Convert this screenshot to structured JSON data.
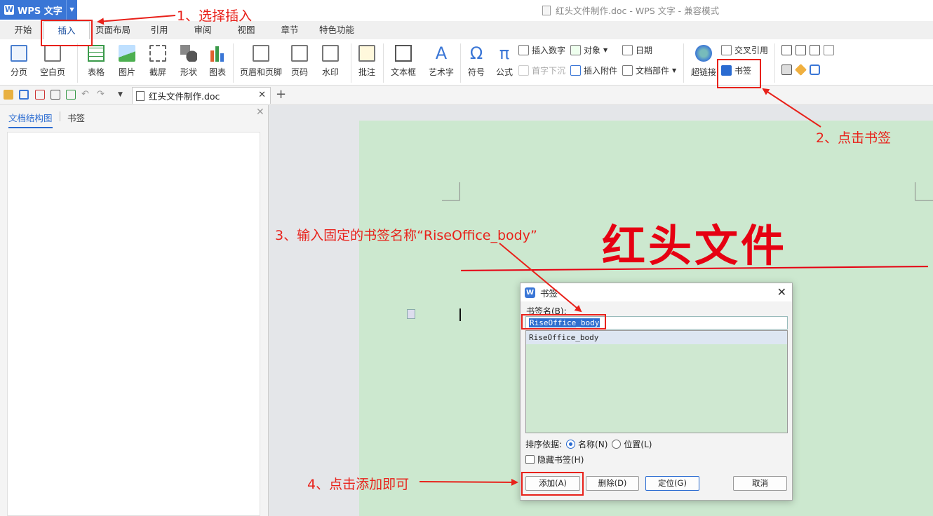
{
  "app": {
    "name": "WPS 文字",
    "window_title": "红头文件制作.doc - WPS 文字 - 兼容模式"
  },
  "menu_tabs": [
    "开始",
    "插入",
    "页面布局",
    "引用",
    "审阅",
    "视图",
    "章节",
    "特色功能"
  ],
  "active_tab": "插入",
  "ribbon": {
    "large": [
      "分页",
      "空白页",
      "表格",
      "图片",
      "截屏",
      "形状",
      "图表",
      "页眉和页脚",
      "页码",
      "水印",
      "批注",
      "文本框",
      "艺术字",
      "符号",
      "公式",
      "超链接"
    ],
    "small": {
      "insert_number": "插入数字",
      "object": "对象",
      "date": "日期",
      "drop_cap": "首字下沉",
      "attach": "插入附件",
      "doc_parts": "文档部件",
      "cross_ref": "交叉引用",
      "bookmark": "书签"
    }
  },
  "document_tab": "红头文件制作.doc",
  "left_pane": {
    "tabs": [
      "文档结构图",
      "书签"
    ]
  },
  "document": {
    "red_title": "红头文件"
  },
  "dialog": {
    "title": "书签",
    "name_label": "书签名(B):",
    "name_value": "RiseOffice_body",
    "list_items": [
      "RiseOffice_body"
    ],
    "sort_label": "排序依据:",
    "sort_by_name": "名称(N)",
    "sort_by_position": "位置(L)",
    "sort_selected": "名称(N)",
    "hide_label": "隐藏书签(H)",
    "hide_checked": false,
    "buttons": {
      "add": "添加(A)",
      "delete": "删除(D)",
      "locate": "定位(G)",
      "cancel": "取消"
    }
  },
  "annotations": {
    "step1": "1、选择插入",
    "step2": "2、点击书签",
    "step3": "3、输入固定的书签名称“RiseOffice_body”",
    "step4": "4、点击添加即可",
    "color": "#e8211a"
  },
  "colors": {
    "accent": "#3a76d6",
    "page": "#cce8cf",
    "red_heading": "#e60012"
  }
}
